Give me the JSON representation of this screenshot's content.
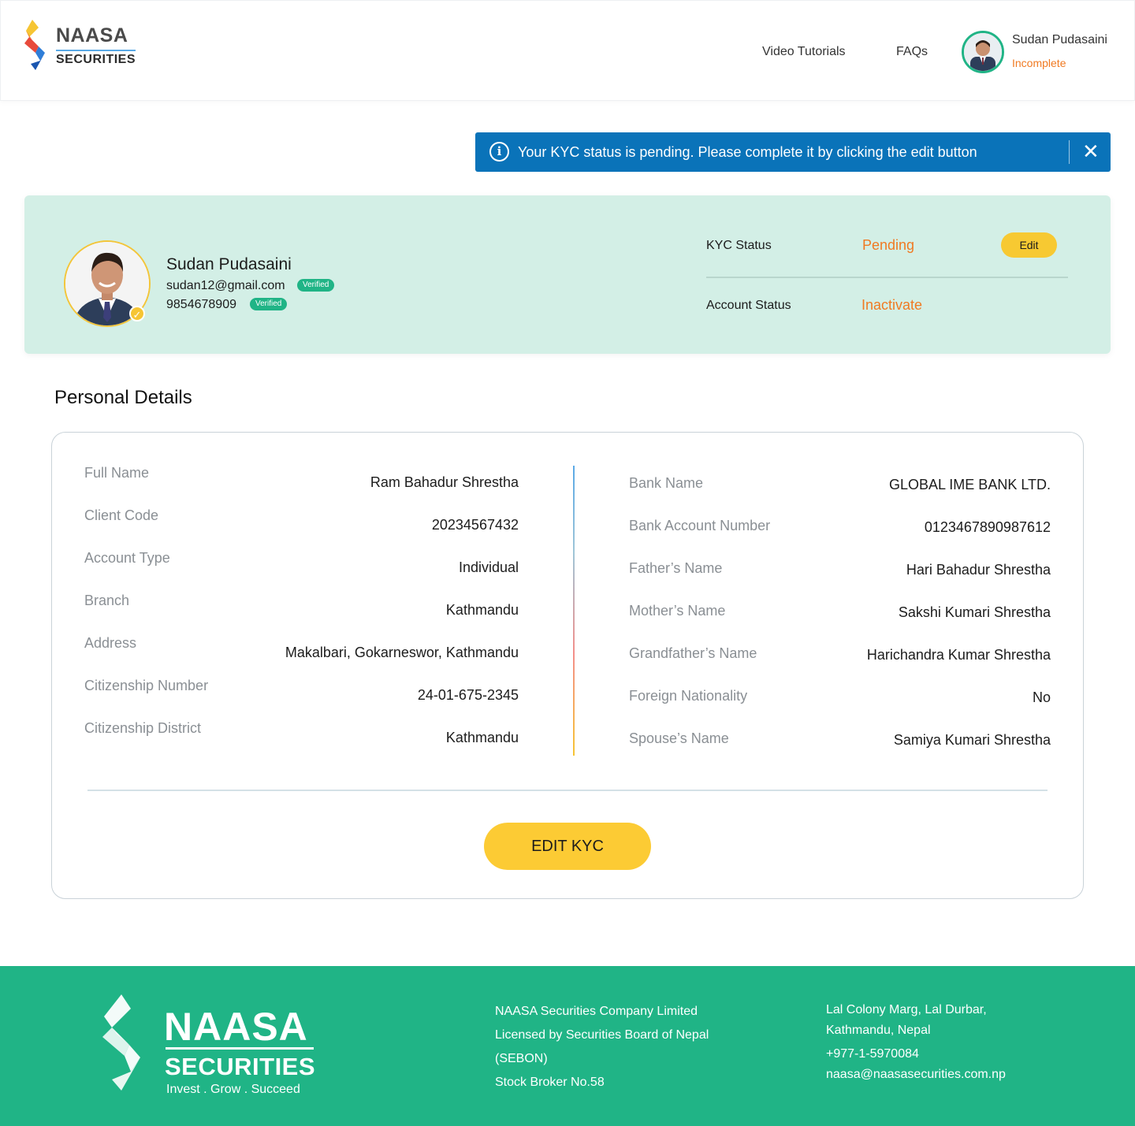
{
  "header": {
    "brand_line1": "NAASA",
    "brand_line2": "SECURITIES",
    "nav": [
      "Video Tutorials",
      "FAQs"
    ],
    "user_name": "Sudan Pudasaini",
    "user_status": "Incomplete"
  },
  "alert": {
    "icon": "i",
    "message": "Your KYC status is pending. Please complete it by clicking the edit button",
    "close": "✕"
  },
  "profile": {
    "name": "Sudan Pudasaini",
    "email": "sudan12@gmail.com",
    "email_badge": "Verified",
    "phone": "9854678909",
    "phone_badge": "Verified",
    "kyc_label": "KYC Status",
    "kyc_value": "Pending",
    "edit_label": "Edit",
    "account_label": "Account Status",
    "account_value": "Inactivate"
  },
  "details": {
    "title": "Personal Details",
    "left": [
      {
        "label": "Full Name",
        "value": "Ram Bahadur Shrestha"
      },
      {
        "label": "Client Code",
        "value": "20234567432"
      },
      {
        "label": "Account Type",
        "value": "Individual"
      },
      {
        "label": "Branch",
        "value": "Kathmandu"
      },
      {
        "label": "Address",
        "value": "Makalbari, Gokarneswor, Kathmandu"
      },
      {
        "label": "Citizenship Number",
        "value": "24-01-675-2345"
      },
      {
        "label": "Citizenship District",
        "value": "Kathmandu"
      }
    ],
    "right": [
      {
        "label": "Bank Name",
        "value": "GLOBAL IME BANK LTD."
      },
      {
        "label": "Bank Account Number",
        "value": "0123467890987612"
      },
      {
        "label": "Father’s Name",
        "value": "Hari Bahadur Shrestha"
      },
      {
        "label": "Mother’s Name",
        "value": "Sakshi Kumari Shrestha"
      },
      {
        "label": "Grandfather’s Name",
        "value": "Harichandra Kumar Shrestha"
      },
      {
        "label": "Foreign Nationality",
        "value": "No"
      },
      {
        "label": "Spouse’s Name",
        "value": "Samiya Kumari Shrestha"
      }
    ],
    "edit_kyc_label": "EDIT KYC"
  },
  "footer": {
    "brand_line1": "NAASA",
    "brand_line2": "SECURITIES",
    "tagline": "Invest . Grow . Succeed",
    "company_lines": [
      "NAASA Securities Company Limited",
      "Licensed by Securities Board of Nepal",
      "(SEBON)",
      "Stock Broker No.58"
    ],
    "address_lines": [
      "Lal Colony Marg, Lal Durbar,",
      "Kathmandu, Nepal"
    ],
    "phone": "+977-1-5970084",
    "email": "naasa@naasasecurities.com.np"
  },
  "colors": {
    "brand_green": "#20b486",
    "alert_blue": "#0a73b9",
    "profile_bg": "#d3efe6",
    "status_orange": "#f07a22",
    "button_yellow": "#fccb34"
  }
}
